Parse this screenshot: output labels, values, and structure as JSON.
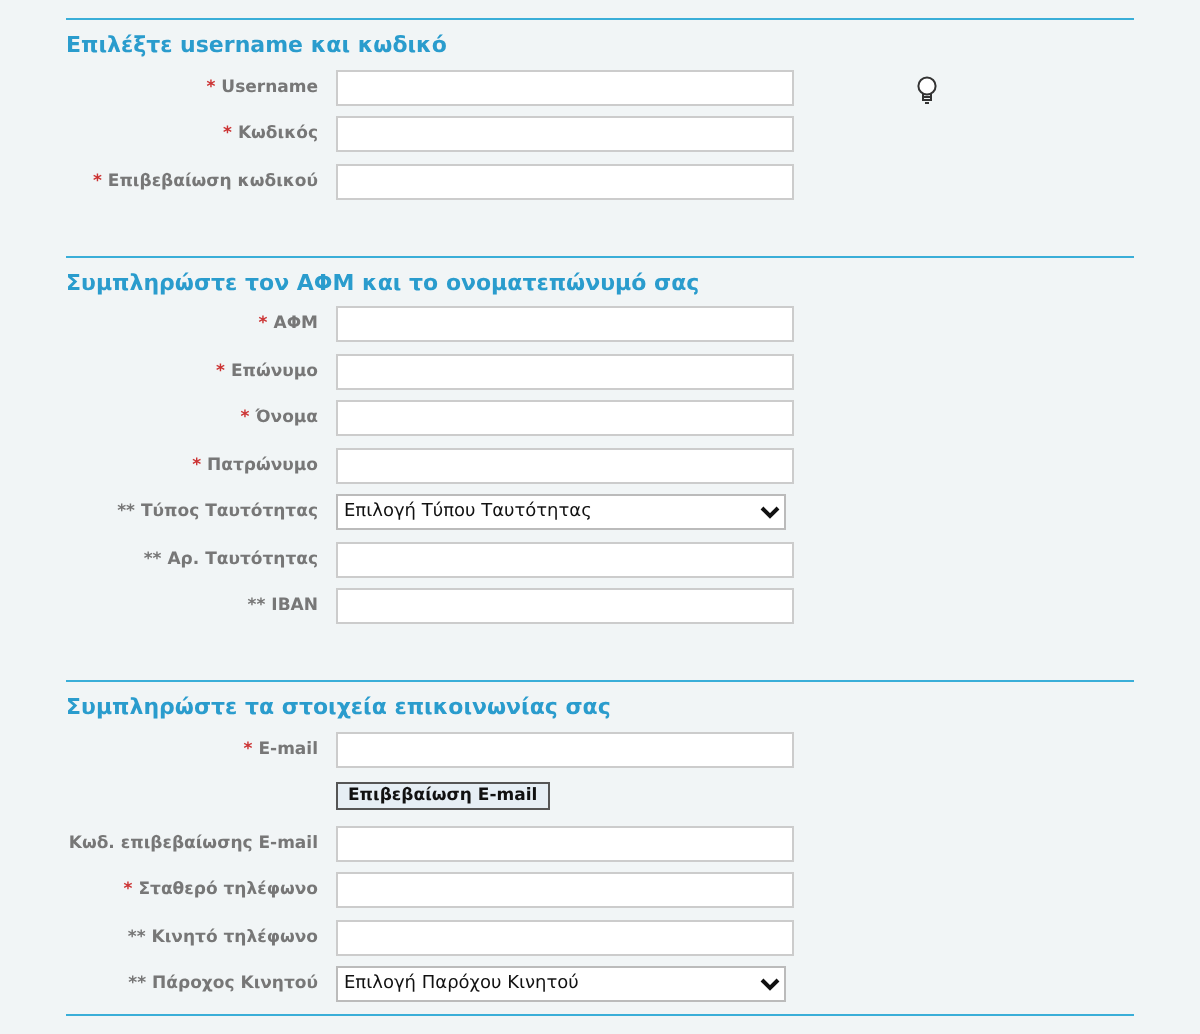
{
  "sections": [
    {
      "heading": "Επιλέξτε username και κωδικό",
      "rows": [
        {
          "kind": "text",
          "marker": "*",
          "required": true,
          "label": "Username",
          "hint_icon": true
        },
        {
          "kind": "text",
          "marker": "*",
          "required": true,
          "label": "Κωδικός"
        },
        {
          "kind": "text",
          "marker": "*",
          "required": true,
          "label": "Επιβεβαίωση κωδικού"
        }
      ]
    },
    {
      "heading": "Συμπληρώστε τον ΑΦΜ και το ονοματεπώνυμό σας",
      "rows": [
        {
          "kind": "text",
          "marker": "*",
          "required": true,
          "label": "ΑΦΜ"
        },
        {
          "kind": "text",
          "marker": "*",
          "required": true,
          "label": "Επώνυμο"
        },
        {
          "kind": "text",
          "marker": "*",
          "required": true,
          "label": "Όνομα"
        },
        {
          "kind": "text",
          "marker": "*",
          "required": true,
          "label": "Πατρώνυμο"
        },
        {
          "kind": "select",
          "marker": "**",
          "required": false,
          "label": "Τύπος Ταυτότητας",
          "value": "Επιλογή Τύπου Ταυτότητας"
        },
        {
          "kind": "text",
          "marker": "**",
          "required": false,
          "label": "Αρ. Ταυτότητας"
        },
        {
          "kind": "text",
          "marker": "**",
          "required": false,
          "label": "IBAN"
        }
      ]
    },
    {
      "heading": "Συμπληρώστε τα στοιχεία επικοινωνίας σας",
      "rows": [
        {
          "kind": "text",
          "marker": "*",
          "required": true,
          "label": "E-mail"
        },
        {
          "kind": "button",
          "button": "Επιβεβαίωση E-mail"
        },
        {
          "kind": "text",
          "label": "Κωδ. επιβεβαίωσης E-mail"
        },
        {
          "kind": "text",
          "marker": "*",
          "required": true,
          "label": "Σταθερό τηλέφωνο"
        },
        {
          "kind": "text",
          "marker": "**",
          "required": false,
          "label": "Κινητό τηλέφωνο"
        },
        {
          "kind": "select",
          "marker": "**",
          "required": false,
          "label": "Πάροχος Κινητού",
          "value": "Επιλογή Παρόχου Κινητού"
        }
      ]
    }
  ]
}
